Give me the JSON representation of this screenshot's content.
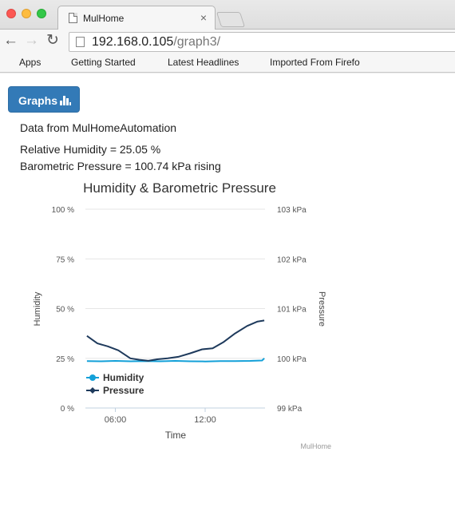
{
  "browser": {
    "tab_title": "MulHome",
    "url_host": "192.168.0.105",
    "url_path": "/graph3/",
    "bookmarks": [
      "Apps",
      "Getting Started",
      "Latest Headlines",
      "Imported From Firefo"
    ]
  },
  "page": {
    "button_label": "Graphs",
    "data_source": "Data from MulHomeAutomation",
    "humidity_line": "Relative Humidity = 25.05 %",
    "pressure_line": "Barometric Pressure = 100.74 kPa rising"
  },
  "chart_data": {
    "type": "line",
    "title": "Humidity & Barometric Pressure",
    "xlabel": "Time",
    "ylabel": "Humidity",
    "ylabel_right": "Pressure",
    "credits": "MulHome",
    "x_ticks": [
      "06:00",
      "12:00"
    ],
    "y_ticks": [
      "0 %",
      "25 %",
      "50 %",
      "75 %",
      "100 %"
    ],
    "y_right_ticks": [
      "99 kPa",
      "100 kPa",
      "101 kPa",
      "102 kPa",
      "103 kPa"
    ],
    "ylim": [
      0,
      100
    ],
    "ylim_right": [
      99,
      103
    ],
    "xlim": [
      4,
      16
    ],
    "legend_position": "bottom-left",
    "series": [
      {
        "name": "Humidity",
        "color": "#13a0d8",
        "axis": "left",
        "x": [
          4.1,
          5.0,
          6.0,
          7.0,
          8.0,
          9.0,
          10.0,
          11.0,
          12.0,
          13.0,
          14.0,
          15.0,
          15.8,
          15.95
        ],
        "values": [
          23.6,
          23.5,
          23.7,
          23.5,
          23.6,
          23.5,
          23.7,
          23.5,
          23.4,
          23.6,
          23.6,
          23.7,
          23.9,
          25.0
        ]
      },
      {
        "name": "Pressure",
        "color": "#1e3a5c",
        "axis": "right",
        "x": [
          4.1,
          4.8,
          5.5,
          6.2,
          7.0,
          7.6,
          8.2,
          8.8,
          9.5,
          10.2,
          11.0,
          11.8,
          12.5,
          13.2,
          14.0,
          14.8,
          15.5,
          15.95
        ],
        "values": [
          100.45,
          100.3,
          100.24,
          100.16,
          100.0,
          99.97,
          99.95,
          99.98,
          100.0,
          100.03,
          100.1,
          100.18,
          100.2,
          100.32,
          100.5,
          100.65,
          100.74,
          100.76
        ]
      }
    ]
  }
}
